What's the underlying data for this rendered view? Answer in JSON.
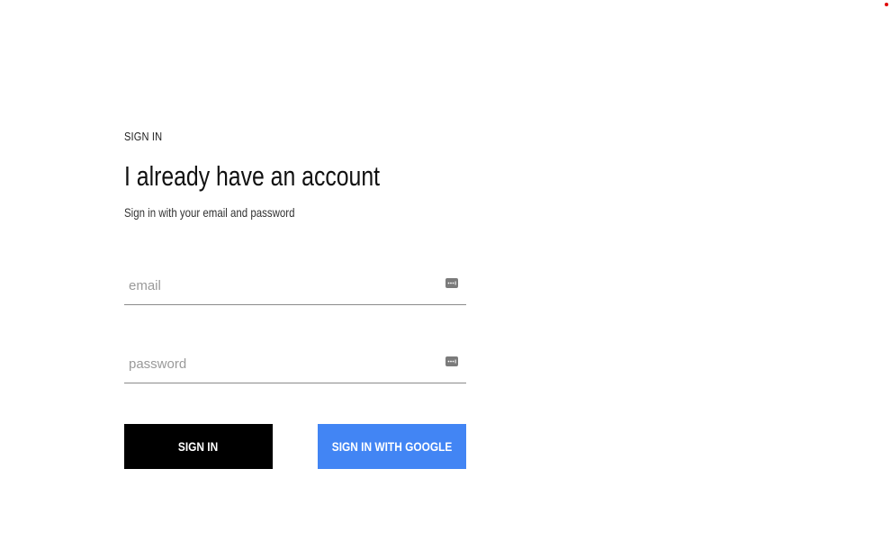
{
  "signin": {
    "kicker": "SIGN IN",
    "title": "I already have an account",
    "subtitle": "Sign in with your email and password",
    "email": {
      "placeholder": "email",
      "value": "",
      "icon": "password-manager-key-icon"
    },
    "password": {
      "placeholder": "password",
      "value": "",
      "icon": "password-manager-key-icon"
    },
    "buttons": {
      "signin_label": "SIGN IN",
      "google_label": "SIGN IN WITH GOOGLE"
    }
  },
  "colors": {
    "signin_button": "#000000",
    "google_button": "#4285f4",
    "indicator_dot": "#e00000"
  }
}
